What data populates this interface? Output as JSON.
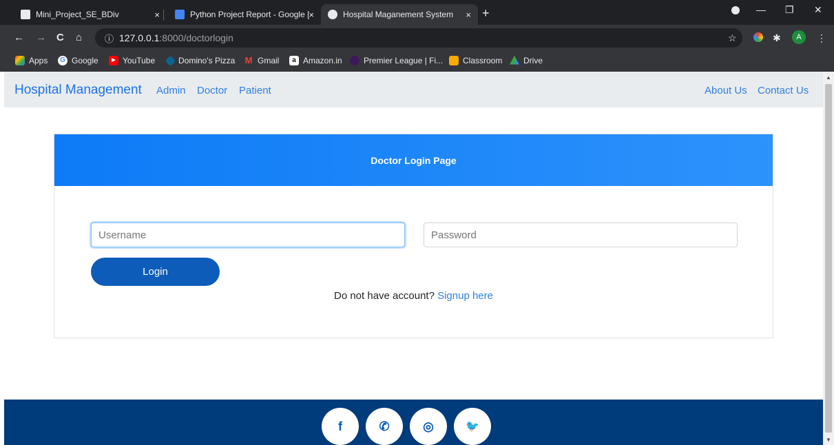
{
  "browser": {
    "tabs": [
      {
        "label": "Mini_Project_SE_BDiv",
        "close": "×"
      },
      {
        "label": "Python Project Report - Google [",
        "close": "×"
      },
      {
        "label": "Hospital Maganement System",
        "close": "×"
      }
    ],
    "new_tab": "+",
    "window_controls": {
      "minimize": "—",
      "restore": "❐",
      "close": "✕"
    },
    "nav": {
      "back": "←",
      "forward": "→",
      "reload": "C",
      "home": "⌂"
    },
    "url": {
      "info": "ⓘ",
      "host": "127.0.0.1",
      "path": ":8000/doctorlogin"
    },
    "star": "☆",
    "profile": "A",
    "menu": "⋮",
    "bookmarks": [
      {
        "label": "Apps",
        "icon": "apps-grid-icon",
        "color": "#ea4335"
      },
      {
        "label": "Google",
        "icon": "google-icon",
        "color": "#ffffff"
      },
      {
        "label": "YouTube",
        "icon": "youtube-icon",
        "color": "#ff0000"
      },
      {
        "label": "Domino's Pizza",
        "icon": "dominos-icon",
        "color": "#0b648f"
      },
      {
        "label": "Gmail",
        "icon": "gmail-icon",
        "color": "#ea4335"
      },
      {
        "label": "Amazon.in",
        "icon": "amazon-icon",
        "color": "#ffffff"
      },
      {
        "label": "Premier League | Fi...",
        "icon": "premier-league-icon",
        "color": "#3d195b"
      },
      {
        "label": "Classroom",
        "icon": "classroom-icon",
        "color": "#f9ab00"
      },
      {
        "label": "Drive",
        "icon": "drive-icon",
        "color": "#34a853"
      }
    ]
  },
  "site": {
    "brand": "Hospital Management",
    "nav_left": [
      "Admin",
      "Doctor",
      "Patient"
    ],
    "nav_right": [
      "About Us",
      "Contact Us"
    ]
  },
  "login": {
    "title": "Doctor Login Page",
    "username_placeholder": "Username",
    "password_placeholder": "Password",
    "button": "Login",
    "signup_prompt": "Do not have account?",
    "signup_link": "Signup here"
  },
  "footer": {
    "social": [
      {
        "glyph": "f",
        "icon": "facebook-icon"
      },
      {
        "glyph": "✆",
        "icon": "whatsapp-icon"
      },
      {
        "glyph": "◎",
        "icon": "instagram-icon"
      },
      {
        "glyph": "🐦",
        "icon": "twitter-icon"
      }
    ]
  },
  "colors": {
    "primary": "#0d7bf7",
    "link": "#2f7fe0",
    "button": "#0d5cb9",
    "footer": "#003b7b",
    "navbar": "#e9ecef"
  }
}
